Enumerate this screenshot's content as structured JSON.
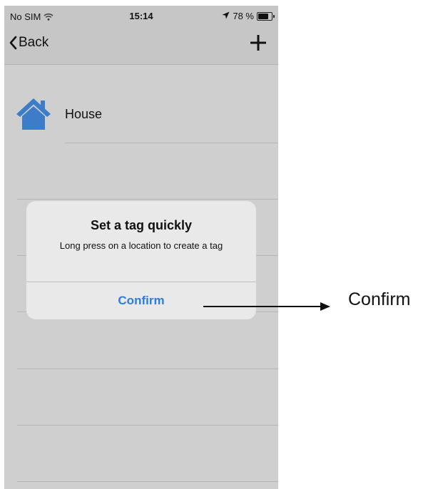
{
  "status_bar": {
    "carrier": "No SIM",
    "time": "15:14",
    "battery": "78 %",
    "battery_level": 0.78
  },
  "nav_bar": {
    "back_label": "Back",
    "add_icon": "plus-icon"
  },
  "list": {
    "items": [
      {
        "label": "House",
        "icon": "house-icon",
        "icon_color": "#3d7cc9"
      }
    ]
  },
  "alert": {
    "title": "Set a tag quickly",
    "message": "Long press on a location to create a tag",
    "confirm_label": "Confirm"
  },
  "annotation": {
    "label": "Confirm"
  },
  "colors": {
    "accent": "#2f7be0",
    "background": "#cfcfcf",
    "alert_background": "#e9e9e9"
  }
}
